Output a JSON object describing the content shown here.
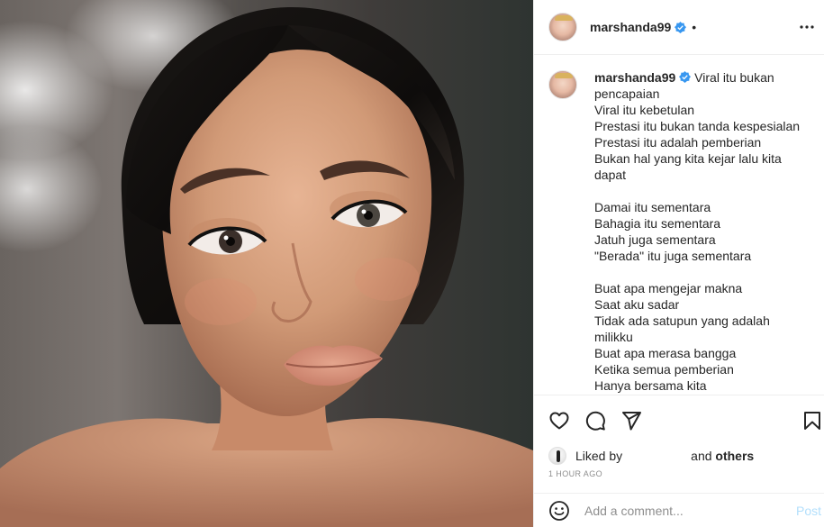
{
  "post": {
    "username": "marshanda99",
    "separator": "•",
    "verified_icon": "verified-badge-icon",
    "more_icon": "more-options-icon"
  },
  "caption": {
    "username": "marshanda99",
    "first_line": "Viral itu bukan pencapaian",
    "lines": [
      "Viral itu kebetulan",
      "Prestasi itu bukan tanda kespesialan",
      "Prestasi itu adalah pemberian",
      "Bukan hal yang kita kejar lalu kita dapat",
      "",
      "Damai itu sementara",
      "Bahagia itu sementara",
      "Jatuh juga sementara",
      "\"Berada\" itu juga sementara",
      "",
      "Buat apa mengejar makna",
      "Saat aku sadar",
      "Tidak ada satupun yang adalah milikku",
      "Buat apa merasa bangga",
      "Ketika semua pemberian",
      "Hanya bersama kita"
    ]
  },
  "actions": {
    "like_icon": "heart-icon",
    "comment_icon": "comment-icon",
    "share_icon": "share-icon",
    "save_icon": "bookmark-icon"
  },
  "likes": {
    "liked_by_label": "Liked by",
    "and_label": "and",
    "others_label": "others"
  },
  "timestamp": "1 HOUR AGO",
  "comment": {
    "emoji_icon": "emoji-icon",
    "placeholder": "Add a comment...",
    "post_label": "Post"
  },
  "colors": {
    "verified": "#3897f0",
    "post_disabled": "#b2dffc",
    "text": "#262626",
    "muted": "#8e8e8e"
  }
}
